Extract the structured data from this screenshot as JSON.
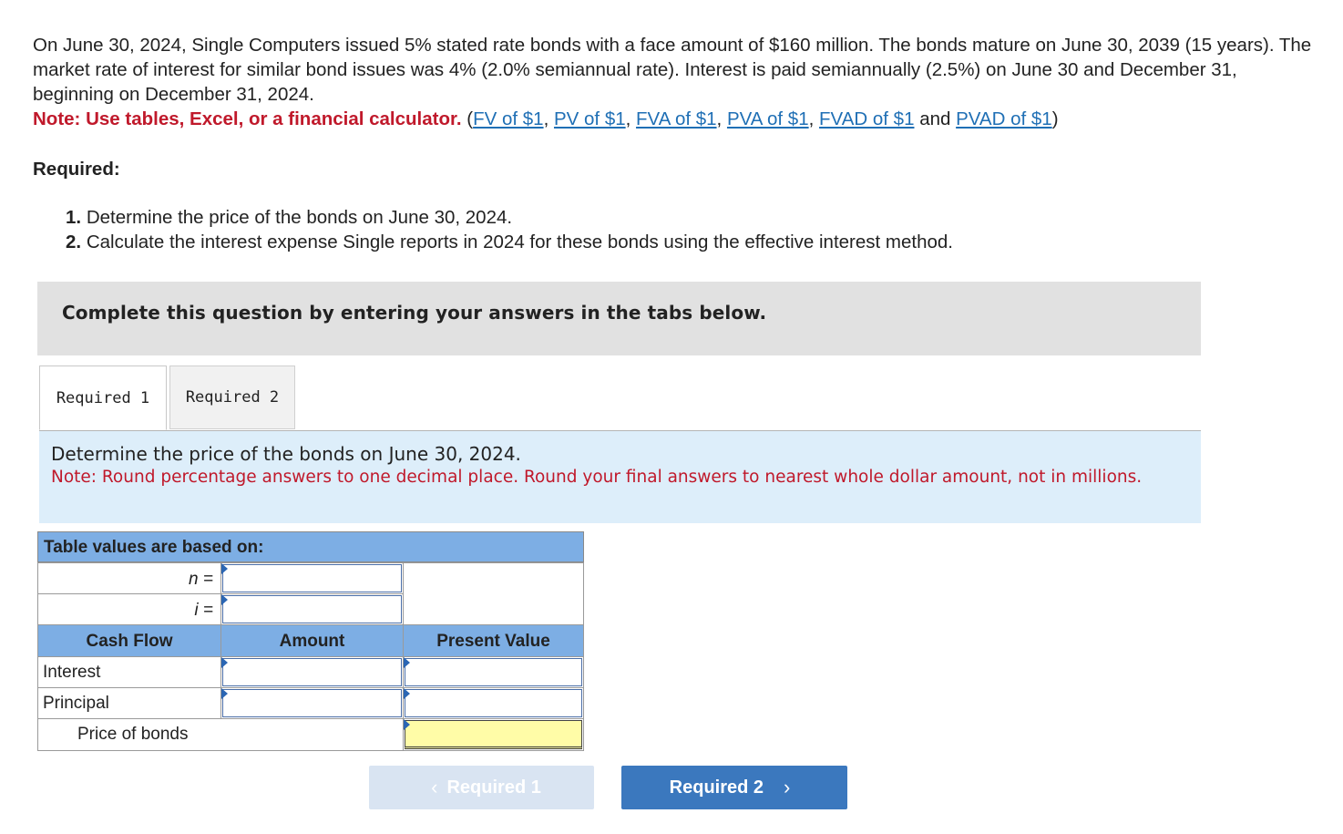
{
  "problem": {
    "paragraph": "On June 30, 2024, Single Computers issued 5% stated rate bonds with a face amount of $160 million. The bonds mature on June 30, 2039 (15 years). The market rate of interest for similar bond issues was 4% (2.0% semiannual rate). Interest is paid semiannually (2.5%) on June 30 and December 31, beginning on December 31, 2024.",
    "note_label": "Note: Use tables, Excel, or a financial calculator.",
    "links": [
      {
        "label": "FV of $1"
      },
      {
        "label": "PV of $1"
      },
      {
        "label": "FVA of $1"
      },
      {
        "label": "PVA of $1"
      },
      {
        "label": "FVAD of $1"
      },
      {
        "label": "PVAD of $1"
      }
    ],
    "and_text": "and"
  },
  "required": {
    "heading": "Required:",
    "items": [
      {
        "num": "1.",
        "text": "Determine the price of the bonds on June 30, 2024."
      },
      {
        "num": "2.",
        "text": "Calculate the interest expense Single reports in 2024 for these bonds using the effective interest method."
      }
    ]
  },
  "instructions_banner": "Complete this question by entering your answers in the tabs below.",
  "tabs": [
    {
      "label": "Required 1",
      "active": true
    },
    {
      "label": "Required 2",
      "active": false
    }
  ],
  "panel": {
    "question": "Determine the price of the bonds on June 30, 2024.",
    "note": "Note: Round percentage answers to one decimal place. Round your final answers to nearest whole dollar amount, not in millions."
  },
  "table": {
    "header": "Table values are based on:",
    "n_label": "n =",
    "i_label": "i =",
    "n_value": "",
    "i_value": "",
    "columns": [
      "Cash Flow",
      "Amount",
      "Present Value"
    ],
    "rows": [
      {
        "label": "Interest",
        "amount": "",
        "present_value": ""
      },
      {
        "label": "Principal",
        "amount": "",
        "present_value": ""
      }
    ],
    "total_label": "Price of bonds",
    "total_value": ""
  },
  "nav": {
    "prev_label": "Required 1",
    "next_label": "Required 2",
    "prev_icon": "‹",
    "next_icon": "›"
  }
}
